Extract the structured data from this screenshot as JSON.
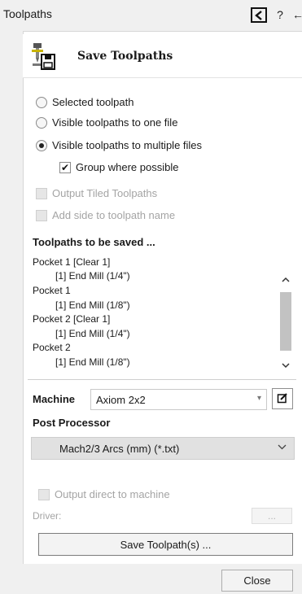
{
  "window": {
    "title": "Toolpaths",
    "help_glyph": "?",
    "pin_glyph": "←"
  },
  "header": {
    "title": "Save Toolpaths",
    "icon": "save-toolpath-icon"
  },
  "options": {
    "selected_toolpath": "Selected toolpath",
    "visible_one_file": "Visible toolpaths to one file",
    "visible_multiple_files": "Visible toolpaths to multiple files",
    "selected_option": "visible_multiple_files",
    "group_where_possible": "Group where possible",
    "group_checked": true,
    "output_tiled": "Output Tiled Toolpaths",
    "add_side": "Add side to toolpath name"
  },
  "toolpaths": {
    "heading": "Toolpaths to be saved ...",
    "items": [
      "Pocket 1 [Clear 1]",
      "[1] End Mill (1/4\")",
      "Pocket 1",
      "[1] End Mill (1/8\")",
      "Pocket 2 [Clear 1]",
      "[1] End Mill (1/4\")",
      "Pocket 2",
      "[1] End Mill (1/8\")"
    ]
  },
  "machine": {
    "label": "Machine",
    "value": "Axiom 2x2"
  },
  "post_processor": {
    "label": "Post Processor",
    "value": "Mach2/3 Arcs (mm) (*.txt)"
  },
  "output": {
    "direct_label": "Output direct to machine",
    "driver_label": "Driver:",
    "driver_button": "..."
  },
  "buttons": {
    "save": "Save Toolpath(s) ...",
    "close": "Close"
  },
  "colors": {
    "panel_background": "#ffffff",
    "window_background": "#f0f0f0",
    "disabled_text": "#a4a4a4"
  }
}
